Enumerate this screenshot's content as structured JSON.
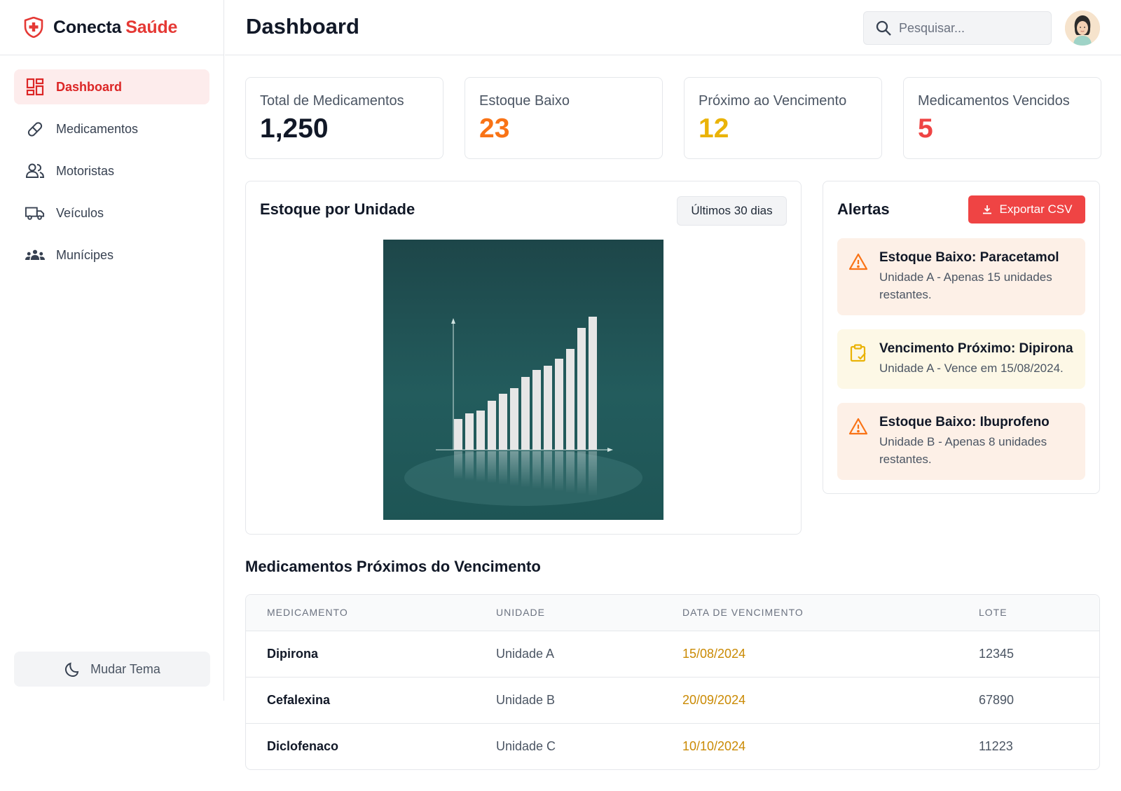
{
  "brand": {
    "name_part1": "Conecta",
    "name_part2": "Saúde"
  },
  "sidebar": {
    "items": [
      {
        "label": "Dashboard",
        "icon": "dashboard-icon",
        "active": true
      },
      {
        "label": "Medicamentos",
        "icon": "pill-icon",
        "active": false
      },
      {
        "label": "Motoristas",
        "icon": "users-icon",
        "active": false
      },
      {
        "label": "Veículos",
        "icon": "truck-icon",
        "active": false
      },
      {
        "label": "Munícipes",
        "icon": "group-icon",
        "active": false
      }
    ],
    "theme_button": "Mudar Tema"
  },
  "header": {
    "title": "Dashboard",
    "search_placeholder": "Pesquisar..."
  },
  "stats": [
    {
      "title": "Total de Medicamentos",
      "value": "1,250",
      "color": "#111827"
    },
    {
      "title": "Estoque Baixo",
      "value": "23",
      "color": "#f97316"
    },
    {
      "title": "Próximo ao Vencimento",
      "value": "12",
      "color": "#eab308"
    },
    {
      "title": "Medicamentos Vencidos",
      "value": "5",
      "color": "#ef4444"
    }
  ],
  "chart": {
    "title": "Estoque por Unidade",
    "range": "Últimos 30 dias"
  },
  "alerts": {
    "title": "Alertas",
    "export_label": "Exportar CSV",
    "items": [
      {
        "type": "warn",
        "icon": "warning-icon",
        "title": "Estoque Baixo: Paracetamol",
        "body": "Unidade A - Apenas 15 unidades restantes."
      },
      {
        "type": "exp",
        "icon": "clipboard-check-icon",
        "title": "Vencimento Próximo: Dipirona",
        "body": "Unidade A - Vence em 15/08/2024."
      },
      {
        "type": "warn",
        "icon": "warning-icon",
        "title": "Estoque Baixo: Ibuprofeno",
        "body": "Unidade B - Apenas 8 unidades restantes."
      }
    ]
  },
  "table": {
    "title": "Medicamentos Próximos do Vencimento",
    "columns": [
      "MEDICAMENTO",
      "UNIDADE",
      "DATA DE VENCIMENTO",
      "LOTE"
    ],
    "rows": [
      [
        "Dipirona",
        "Unidade A",
        "15/08/2024",
        "12345"
      ],
      [
        "Cefalexina",
        "Unidade B",
        "20/09/2024",
        "67890"
      ],
      [
        "Diclofenaco",
        "Unidade C",
        "10/10/2024",
        "11223"
      ]
    ]
  },
  "colors": {
    "accent": "#ef4444",
    "warning": "#f97316",
    "expiry": "#ca8a04"
  }
}
